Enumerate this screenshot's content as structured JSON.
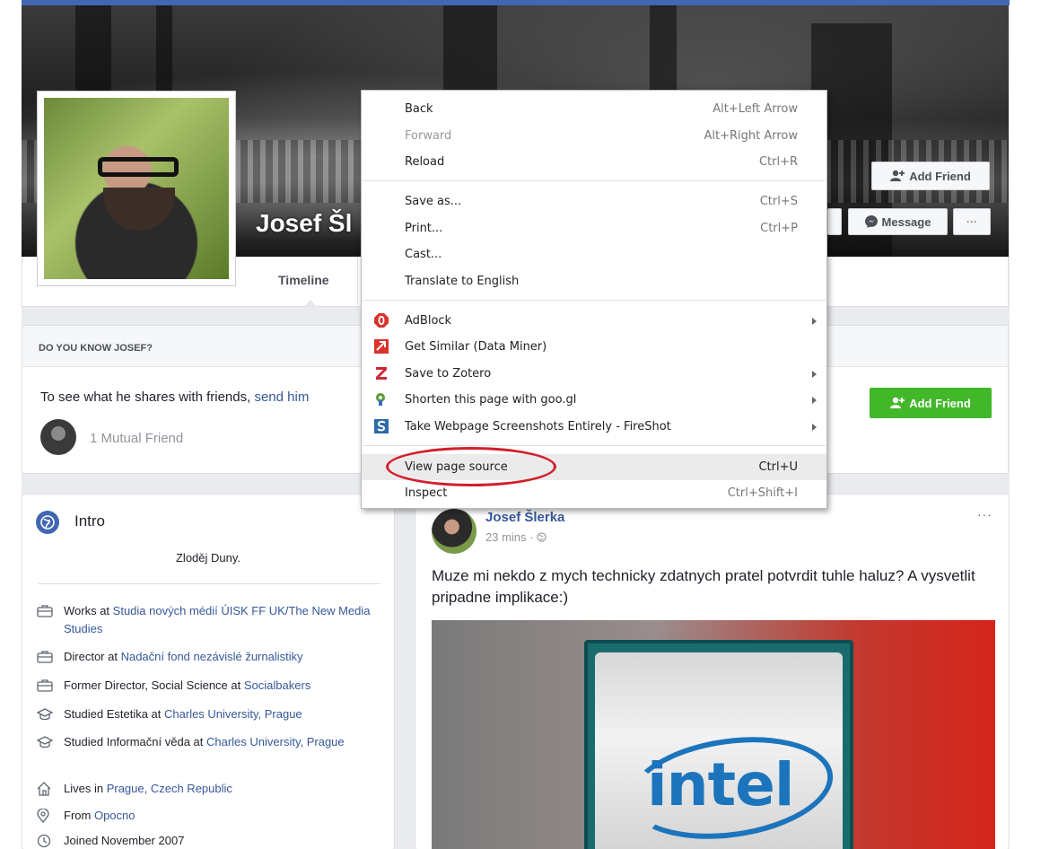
{
  "profile": {
    "name": "Josef Šl",
    "tab_timeline": "Timeline",
    "add_friend_label": "Add Friend",
    "message_label": "Message",
    "more_label": "···"
  },
  "know": {
    "title": "DO YOU KNOW JOSEF?",
    "text": "To see what he shares with friends, ",
    "link": "send him",
    "mutual": "1 Mutual Friend",
    "add_friend_label": "Add Friend"
  },
  "intro": {
    "title": "Intro",
    "bio": "Zloděj Duny.",
    "rows": [
      {
        "icon": "briefcase-icon",
        "pre": "Works at ",
        "link": "Studia nových médií ÚISK FF UK/The New Media Studies"
      },
      {
        "icon": "briefcase-icon",
        "pre": "Director at ",
        "link": "Nadační fond nezávislé žurnalistiky"
      },
      {
        "icon": "briefcase-icon",
        "pre": "Former Director, Social Science at ",
        "link": "Socialbakers"
      },
      {
        "icon": "graduation-cap-icon",
        "pre": "Studied Estetika at ",
        "link": "Charles University, Prague"
      },
      {
        "icon": "graduation-cap-icon",
        "pre": "Studied Informační věda at ",
        "link": "Charles University, Prague"
      },
      {
        "icon": "home-icon",
        "pre": "Lives in ",
        "link": "Prague, Czech Republic"
      },
      {
        "icon": "location-pin-icon",
        "pre": "From ",
        "link": "Opocno"
      },
      {
        "icon": "clock-icon",
        "pre": "Joined November 2007",
        "link": ""
      }
    ]
  },
  "post": {
    "author": "Josef Šlerka",
    "time": "23 mins ·",
    "more": "···",
    "text": "Muze mi nekdo z mych technicky zdatnych pratel potvrdit tuhle haluz? A vysvetlit pripadne implikace:)",
    "image_brand": "intel"
  },
  "context_menu": {
    "items": [
      {
        "label": "Back",
        "shortcut": "Alt+Left Arrow",
        "disabled": false
      },
      {
        "label": "Forward",
        "shortcut": "Alt+Right Arrow",
        "disabled": true
      },
      {
        "label": "Reload",
        "shortcut": "Ctrl+R",
        "disabled": false
      },
      {
        "label": "Save as...",
        "shortcut": "Ctrl+S",
        "disabled": false
      },
      {
        "label": "Print...",
        "shortcut": "Ctrl+P",
        "disabled": false
      },
      {
        "label": "Cast...",
        "shortcut": "",
        "disabled": false
      },
      {
        "label": "Translate to English",
        "shortcut": "",
        "disabled": false
      },
      {
        "label": "AdBlock",
        "shortcut": "",
        "submenu": true,
        "icon": "adblock-icon"
      },
      {
        "label": "Get Similar (Data Miner)",
        "shortcut": "",
        "icon": "data-miner-icon"
      },
      {
        "label": "Save to Zotero",
        "shortcut": "",
        "submenu": true,
        "icon": "zotero-icon"
      },
      {
        "label": "Shorten this page with goo.gl",
        "shortcut": "",
        "submenu": true,
        "icon": "googl-icon"
      },
      {
        "label": "Take Webpage Screenshots Entirely - FireShot",
        "shortcut": "",
        "submenu": true,
        "icon": "fireshot-icon"
      },
      {
        "label": "View page source",
        "shortcut": "Ctrl+U",
        "highlighted": true
      },
      {
        "label": "Inspect",
        "shortcut": "Ctrl+Shift+I"
      }
    ]
  },
  "colors": {
    "facebook_blue": "#4267b2",
    "link_blue": "#365899",
    "green": "#42b72a",
    "annotation_red": "#d21f2c"
  }
}
